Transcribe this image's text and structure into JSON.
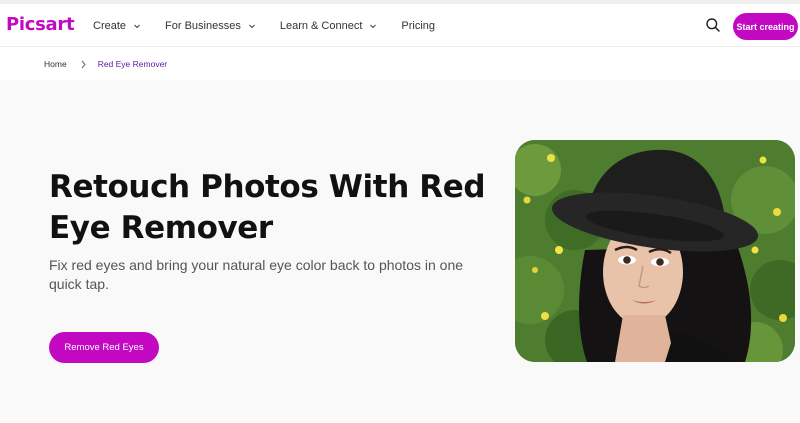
{
  "brand": {
    "logo_text": "Picsart",
    "accent": "#c209c1",
    "breadcrumb_active": "#5a1aa5"
  },
  "nav": {
    "items": [
      {
        "label": "Create",
        "has_dropdown": true
      },
      {
        "label": "For Businesses",
        "has_dropdown": true
      },
      {
        "label": "Learn & Connect",
        "has_dropdown": true
      },
      {
        "label": "Pricing",
        "has_dropdown": false
      }
    ],
    "search_icon": "search-icon",
    "cta_label": "Start creating"
  },
  "breadcrumb": {
    "home": "Home",
    "current": "Red Eye Remover"
  },
  "hero": {
    "title": "Retouch Photos With Red Eye Remover",
    "subtitle": "Fix red eyes and bring your natural eye color back to photos in one quick tap.",
    "button_label": "Remove Red Eyes",
    "image": "portrait of woman in black hat"
  }
}
